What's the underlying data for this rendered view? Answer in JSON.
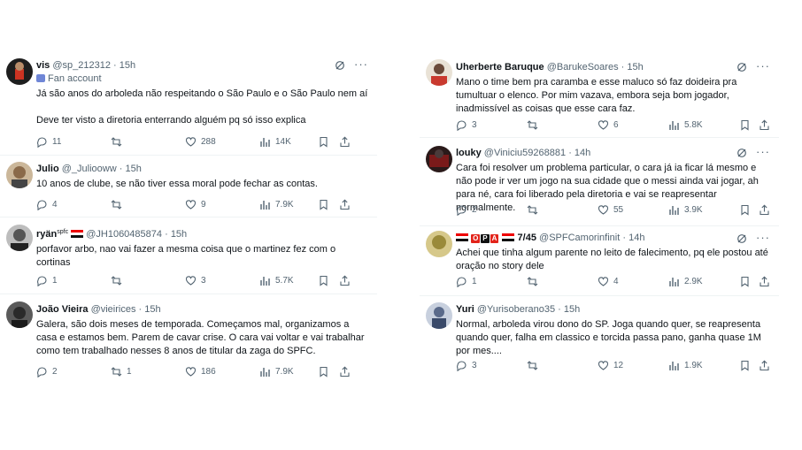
{
  "left": [
    {
      "name": "vis",
      "handle": "@sp_212312",
      "time": "15h",
      "fan_label": "Fan account",
      "text": [
        "Já são anos do arboleda não respeitando o São Paulo e o São Paulo nem aí",
        "Deve ter visto a diretoria enterrando alguém pq só isso explica"
      ],
      "replies": "11",
      "retweets": "",
      "likes": "288",
      "views": "14K",
      "avatar_color": "#222222"
    },
    {
      "name": "Julio",
      "handle": "@_Juliooww",
      "time": "15h",
      "text": [
        "10 anos de clube, se não tiver essa moral pode fechar as contas."
      ],
      "replies": "4",
      "retweets": "",
      "likes": "9",
      "views": "7.9K",
      "avatar_color": "#8a6a4a"
    },
    {
      "name": "ryän",
      "name_tag": "spfc",
      "handle": "@JH1060485874",
      "time": "15h",
      "text": [
        "porfavor arbo, nao vai fazer a mesma coisa que o martinez fez com o cortinas"
      ],
      "replies": "1",
      "retweets": "",
      "likes": "3",
      "views": "5.7K",
      "avatar_color": "#555555"
    },
    {
      "name": "João Vieira",
      "handle": "@vieirices",
      "time": "15h",
      "text": [
        "Galera, são dois meses de temporada. Começamos mal, organizamos a casa e estamos bem. Parem de cavar crise. O cara vai voltar e vai trabalhar como tem trabalhado nesses 8 anos de titular da zaga do SPFC."
      ],
      "replies": "2",
      "retweets": "1",
      "likes": "186",
      "views": "7.9K",
      "avatar_color": "#3a3a3a"
    }
  ],
  "right": [
    {
      "name": "Uherberte Baruque",
      "handle": "@BarukeSoares",
      "time": "15h",
      "text": [
        "Mano o time bem pra caramba e esse maluco só faz doideira pra tumultuar o elenco. Por mim vazava, embora seja bom jogador, inadmissível as coisas que esse cara faz."
      ],
      "replies": "3",
      "retweets": "",
      "likes": "6",
      "views": "5.8K",
      "avatar_color": "#c93a2f"
    },
    {
      "name": "louky",
      "handle": "@Viniciu59268881",
      "time": "14h",
      "text": [
        "Cara foi resolver um problema particular, o cara já ia ficar lá mesmo e não pode ir ver um jogo na sua cidade que o messi ainda vai jogar, ah para né, cara foi liberado pela diretoria e vai se reapresentar normalmente."
      ],
      "replies": "2",
      "retweets": "",
      "likes": "55",
      "views": "3.9K",
      "avatar_color": "#7a1a1a"
    },
    {
      "name_badges": [
        "O",
        "P",
        "A"
      ],
      "name_suffix": "7/45",
      "handle": "@SPFCamorinfinit",
      "time": "14h",
      "text": [
        "Achei que tinha algum parente no leito de falecimento, pq ele postou até oração no story dele"
      ],
      "replies": "1",
      "retweets": "",
      "likes": "4",
      "views": "2.9K",
      "avatar_color": "#9a8a3a"
    },
    {
      "name": "Yuri",
      "handle": "@Yurisoberano35",
      "time": "15h",
      "text": [
        "Normal, arboleda virou dono do SP. Joga quando quer, se reapresenta quando quer, falha em classico e torcida passa pano, ganha quase 1M por mes...."
      ],
      "replies": "3",
      "retweets": "",
      "likes": "12",
      "views": "1.9K",
      "avatar_color": "#5a6a8a"
    }
  ],
  "dot": "·",
  "more": "···"
}
